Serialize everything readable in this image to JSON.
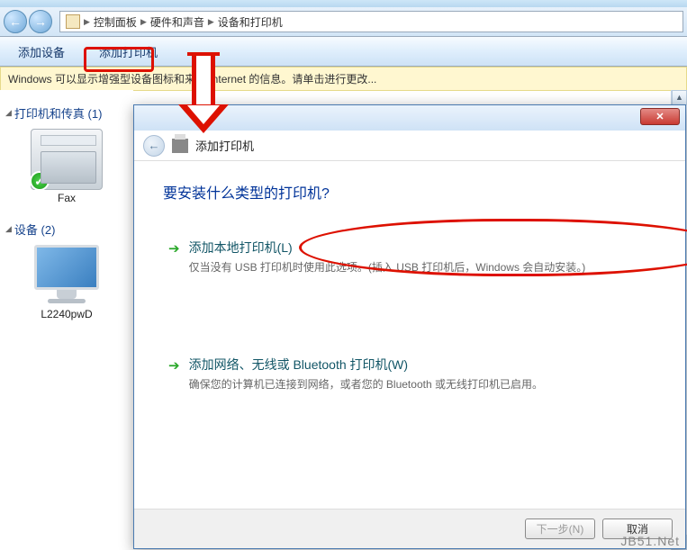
{
  "breadcrumb": {
    "root": "控制面板",
    "mid": "硬件和声音",
    "leaf": "设备和打印机"
  },
  "cmdbar": {
    "add_device": "添加设备",
    "add_printer": "添加打印机"
  },
  "infobar": {
    "text": "Windows 可以显示增强型设备图标和来自 Internet 的信息。请单击进行更改..."
  },
  "left": {
    "cat_printers": "打印机和传真 (1)",
    "fax_label": "Fax",
    "cat_devices": "设备 (2)",
    "monitor_label": "L2240pwD"
  },
  "dialog": {
    "head_title": "添加打印机",
    "h1": "要安装什么类型的打印机?",
    "opt1_title": "添加本地打印机(L)",
    "opt1_desc": "仅当没有 USB 打印机时使用此选项。(插入 USB 打印机后，Windows 会自动安装。)",
    "opt2_title": "添加网络、无线或 Bluetooth 打印机(W)",
    "opt2_desc": "确保您的计算机已连接到网络，或者您的 Bluetooth 或无线打印机已启用。",
    "next": "下一步(N)",
    "cancel": "取消"
  },
  "watermark": "JB51.Net"
}
